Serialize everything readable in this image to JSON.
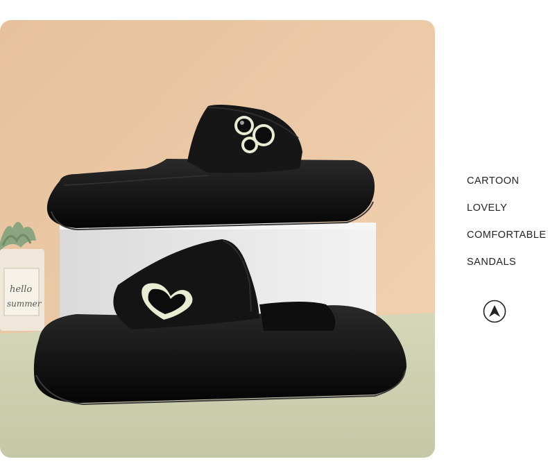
{
  "photo": {
    "alt_colors": {
      "wall": "#edc9a6",
      "floor": "#cfd2b3",
      "slipper": "#111111",
      "accent": "#e7ecd2",
      "block": "#e9e9e9"
    },
    "jar_label": [
      "hello",
      "summer"
    ]
  },
  "features": {
    "items": [
      "CARTOON",
      "LOVELY",
      "COMFORTABLE",
      "SANDALS"
    ]
  },
  "nav": {
    "icon": "arrow-up-circle-icon"
  }
}
